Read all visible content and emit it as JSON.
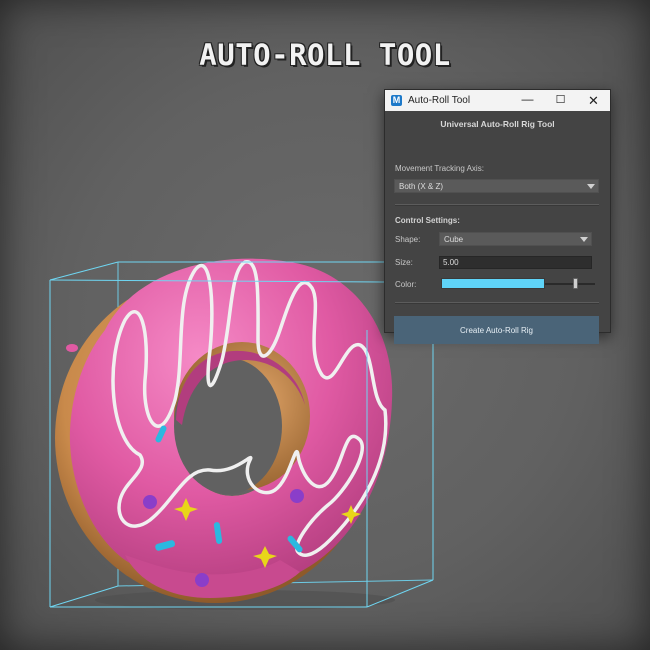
{
  "heading": "AUTO-ROLL TOOL",
  "window": {
    "icon_name": "maya-app-icon",
    "title": "Auto-Roll Tool",
    "controls": {
      "minimize": "—",
      "maximize": "☐",
      "close": "✕"
    }
  },
  "panel": {
    "title": "Universal Auto-Roll Rig Tool",
    "axis": {
      "label": "Movement Tracking Axis:",
      "selected": "Both (X & Z)"
    },
    "control_settings": {
      "label": "Control Settings:",
      "shape_label": "Shape:",
      "shape_selected": "Cube",
      "size_label": "Size:",
      "size_value": "5.00",
      "color_label": "Color:",
      "color_value": "#5fd4f8",
      "color_slider_fraction": 0.87
    },
    "create_button": "Create Auto-Roll Rig"
  },
  "colors": {
    "bounding_box": "#6fd6f2",
    "frosting": "#e05aa3",
    "dough": "#c98a4b",
    "drizzle": "#f0f0f0",
    "sprinkle_blue": "#2bb8e0",
    "sprinkle_purple": "#8a3ec9",
    "sprinkle_star": "#e8d619",
    "button_accent": "#4a6478"
  }
}
